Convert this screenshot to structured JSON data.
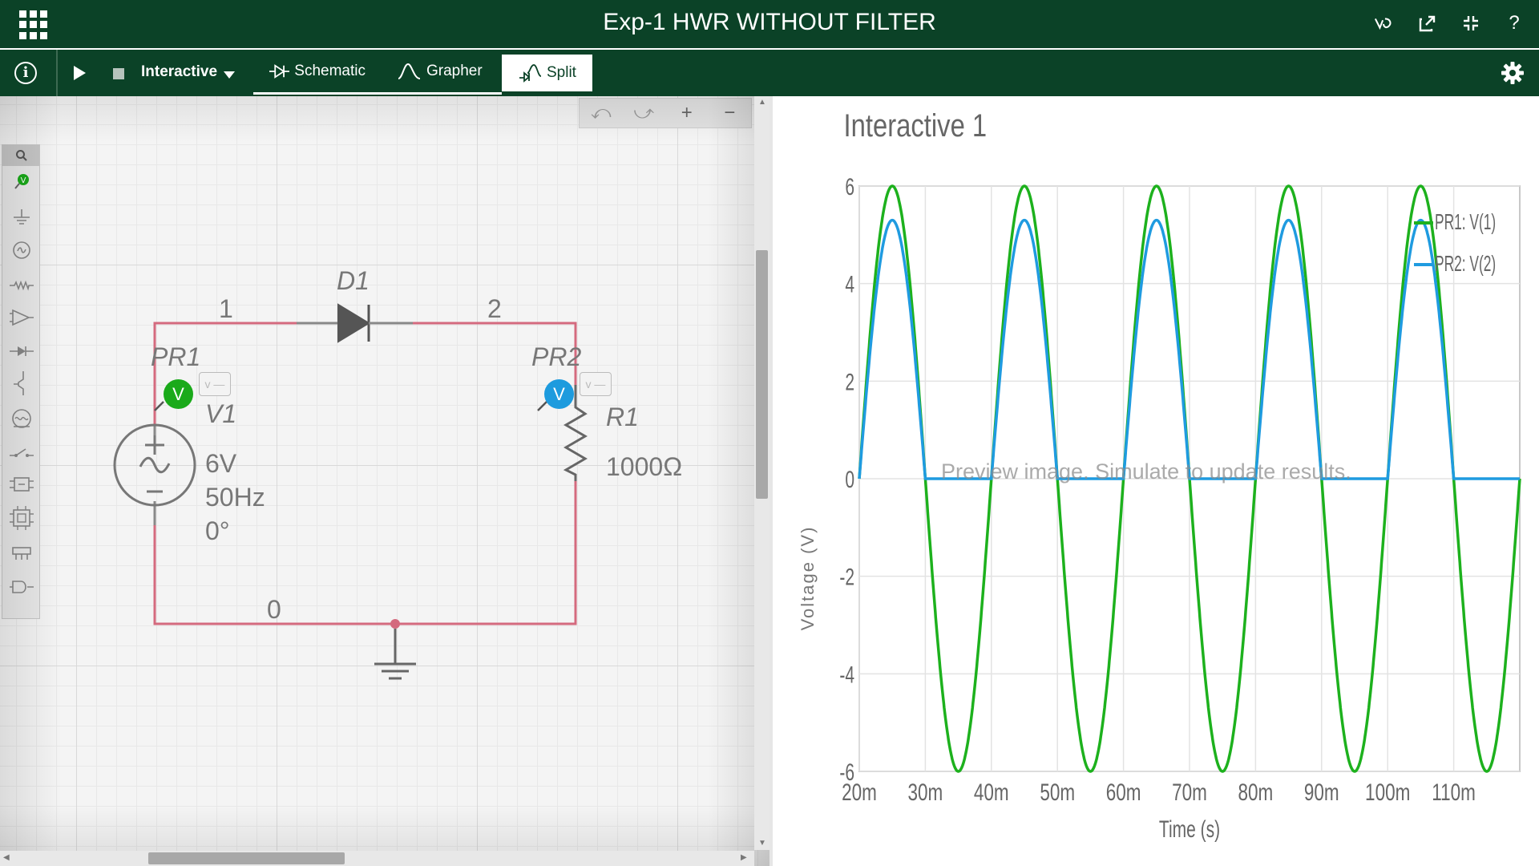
{
  "window": {
    "title": "Exp-1 HWR WITHOUT FILTER",
    "icons": [
      "apps-grid-icon",
      "vertical-scope-icon",
      "popout-icon",
      "collapse-icon",
      "help-icon"
    ],
    "help_label": "?"
  },
  "toolbar": {
    "info_label": "i",
    "mode_label": "Interactive",
    "tabs": [
      {
        "label": "Schematic",
        "icon": "schematic-icon",
        "active": false
      },
      {
        "label": "Grapher",
        "icon": "grapher-icon",
        "active": false
      },
      {
        "label": "Split",
        "icon": "split-icon",
        "active": true
      }
    ],
    "settings_icon": "gear-icon"
  },
  "schematic": {
    "edit_toolbar": {
      "undo": "⤺",
      "redo": "⤻",
      "zoom_in": "+",
      "zoom_out": "−"
    },
    "palette_icons": [
      "search-icon",
      "probe-icon",
      "ground-icon",
      "source-icon",
      "resistor-icon",
      "opamp-icon",
      "diode-icon",
      "transistor-icon",
      "meter-icon",
      "switch-icon",
      "ic-icon",
      "mcu-icon",
      "connector-icon",
      "gate-icon"
    ],
    "probes": [
      {
        "name": "PR1",
        "badge": "V",
        "mini": "v —",
        "color": "#1aaa1a"
      },
      {
        "name": "PR2",
        "badge": "V",
        "mini": "v —",
        "color": "#1d9bde"
      }
    ],
    "components": {
      "diode": {
        "ref": "D1"
      },
      "source": {
        "ref": "V1",
        "voltage": "6V",
        "frequency": "50Hz",
        "phase": "0°"
      },
      "resistor": {
        "ref": "R1",
        "value": "1000Ω"
      }
    },
    "nodes": {
      "n1": "1",
      "n2": "2",
      "n0": "0"
    },
    "wire_color": "#d46a7e"
  },
  "grapher": {
    "title": "Interactive 1",
    "overlay_text": "Preview image. Simulate to update results.",
    "chart_data": {
      "type": "line",
      "title": "Interactive 1",
      "xlabel": "Time (s)",
      "ylabel": "Voltage (V)",
      "xlim": [
        0.02,
        0.12
      ],
      "ylim": [
        -6,
        6
      ],
      "xticks": [
        0.02,
        0.03,
        0.04,
        0.05,
        0.06,
        0.07,
        0.08,
        0.09,
        0.1,
        0.11
      ],
      "xtick_labels": [
        "20m",
        "30m",
        "40m",
        "50m",
        "60m",
        "70m",
        "80m",
        "90m",
        "100m",
        "110m"
      ],
      "yticks": [
        6,
        4,
        2,
        0,
        -2,
        -4,
        -6
      ],
      "grid": true,
      "legend_position": "top-right",
      "series": [
        {
          "name": "PR1: V(1)",
          "color": "#1db11d",
          "kind": "sine",
          "amplitude": 6,
          "frequency_hz": 50,
          "phase_deg": 0
        },
        {
          "name": "PR2: V(2)",
          "color": "#1f9be0",
          "kind": "half-wave",
          "peak": 5.3,
          "frequency_hz": 50
        }
      ]
    }
  }
}
